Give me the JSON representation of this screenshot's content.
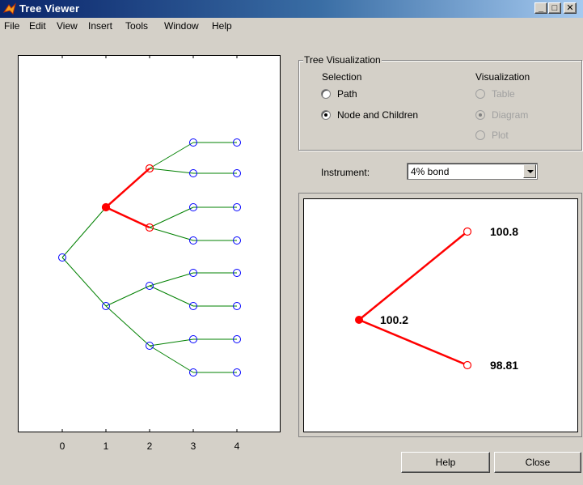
{
  "window": {
    "title": "Tree Viewer"
  },
  "menu": [
    {
      "label": "File"
    },
    {
      "label": "Edit"
    },
    {
      "label": "View"
    },
    {
      "label": "Insert"
    },
    {
      "label": "Tools"
    },
    {
      "label": "Window"
    },
    {
      "label": "Help"
    }
  ],
  "tree_plot": {
    "x_ticks": [
      "0",
      "1",
      "2",
      "3",
      "4"
    ],
    "highlight_color": "#ff0000",
    "edge_color": "#008000",
    "node_color": "#0000ff"
  },
  "tree_visualization": {
    "legend": "Tree Visualization",
    "selection_heading": "Selection",
    "visualization_heading": "Visualization",
    "selection_options": [
      {
        "label": "Path",
        "checked": false
      },
      {
        "label": "Node and Children",
        "checked": true
      }
    ],
    "visualization_options": [
      {
        "label": "Table",
        "checked": false,
        "enabled": false
      },
      {
        "label": "Diagram",
        "checked": true,
        "enabled": false
      },
      {
        "label": "Plot",
        "checked": false,
        "enabled": false
      }
    ]
  },
  "instrument": {
    "label": "Instrument:",
    "value": "4% bond"
  },
  "diagram": {
    "node_value": "100.2",
    "up_value": "100.8",
    "down_value": "98.81"
  },
  "buttons": {
    "help": "Help",
    "close": "Close"
  }
}
